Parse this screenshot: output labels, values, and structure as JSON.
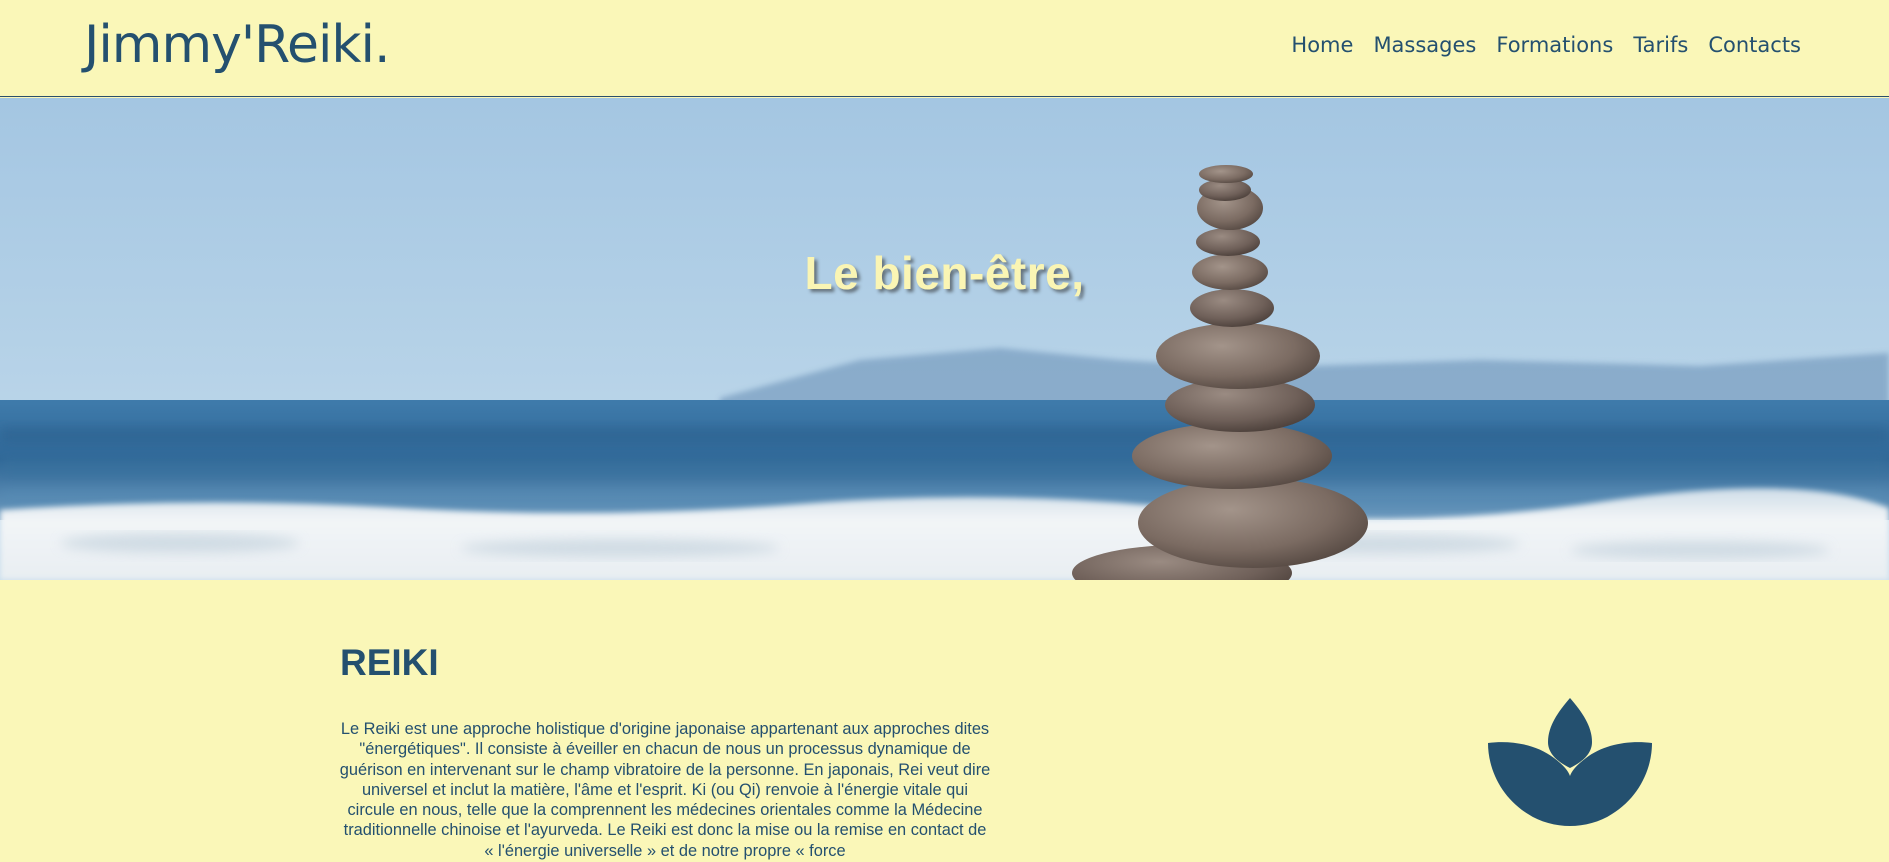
{
  "header": {
    "logo": "Jimmy'Reiki.",
    "nav": [
      {
        "label": "Home"
      },
      {
        "label": "Massages"
      },
      {
        "label": "Formations"
      },
      {
        "label": "Tarifs"
      },
      {
        "label": "Contacts"
      }
    ]
  },
  "hero": {
    "title": "Le bien-être,"
  },
  "reiki": {
    "title": "REIKI",
    "text": "Le Reiki est une approche holistique d'origine japonaise appartenant aux approches dites \"énergétiques\". Il consiste à éveiller en chacun de nous un processus dynamique de guérison en intervenant sur le champ vibratoire de la personne. En japonais, Rei veut dire universel et inclut la matière, l'âme et l'esprit. Ki (ou Qi) renvoie à l'énergie vitale qui circule en nous, telle que la comprennent les médecines orientales comme la Médecine traditionnelle chinoise et l'ayurveda. Le Reiki est donc la mise ou la remise en contact de « l'énergie universelle » et de notre propre « force",
    "icon": "lotus-icon"
  },
  "colors": {
    "background": "#faf7b8",
    "primary": "#24506f",
    "hero_text": "#faf5b4"
  }
}
